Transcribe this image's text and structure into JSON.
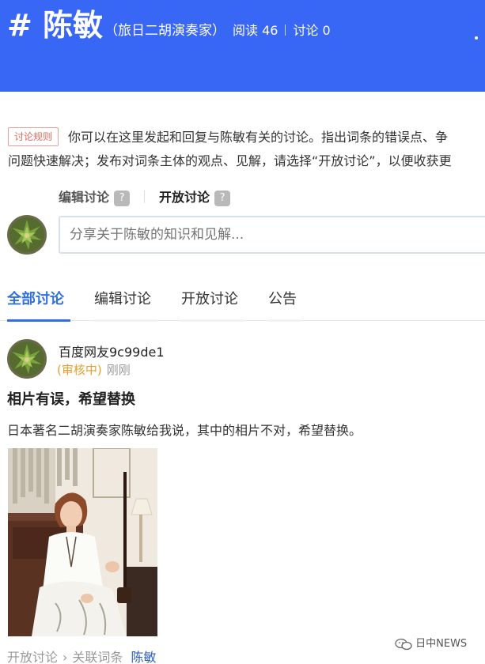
{
  "header": {
    "title": "# 陈敏",
    "subtitle": "（旅日二胡演奏家）",
    "reads": "阅读 46",
    "discussions": "讨论 0"
  },
  "rules": {
    "tag": "讨论规则",
    "line1": "你可以在这里发起和回复与陈敏有关的讨论。指出词条的错误点、争",
    "line2": "问题快速解决；发布对词条主体的观点、见解，请选择“开放讨论”，以便收获更"
  },
  "discussion_type": {
    "edit": "编辑讨论",
    "open": "开放讨论",
    "help": "?"
  },
  "composer": {
    "placeholder": "分享关于陈敏的知识和见解..."
  },
  "tabs": [
    {
      "label": "全部讨论"
    },
    {
      "label": "编辑讨论"
    },
    {
      "label": "开放讨论"
    },
    {
      "label": "公告"
    }
  ],
  "post": {
    "username": "百度网友9c99de1",
    "status": "(审核中)",
    "time": "刚刚",
    "title": "相片有误，希望替换",
    "body": "日本著名二胡演奏家陈敏给我说，其中的相片不对，希望替换。"
  },
  "breadcrumb": {
    "open": "开放讨论",
    "chev": "›",
    "related": "关联词条",
    "entry": "陈敏"
  },
  "watermark": {
    "text": "日中NEWS"
  },
  "colors": {
    "header_bg": "#3866f5",
    "tab_active": "#2f6fe0",
    "status_pending": "#e69f2c"
  }
}
